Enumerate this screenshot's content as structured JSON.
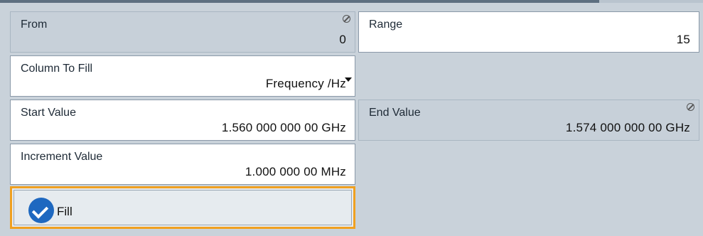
{
  "from": {
    "label": "From",
    "value": "0"
  },
  "range": {
    "label": "Range",
    "value": "15"
  },
  "column_to_fill": {
    "label": "Column To Fill",
    "value": "Frequency /Hz"
  },
  "start_value": {
    "label": "Start Value",
    "value": "1.560 000 000 00 GHz"
  },
  "end_value": {
    "label": "End Value",
    "value": "1.574 000 000 00 GHz"
  },
  "increment_value": {
    "label": "Increment Value",
    "value": "1.000 000 00 MHz"
  },
  "fill_button": {
    "label": "Fill"
  },
  "colors": {
    "accent": "#f0a020",
    "check": "#1e68c0",
    "readonly_bg": "#c7d0d9"
  }
}
